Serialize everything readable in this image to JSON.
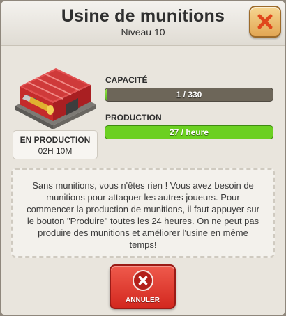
{
  "header": {
    "title": "Usine de munitions",
    "subtitle": "Niveau 10",
    "close_icon": "close-x-icon"
  },
  "status": {
    "label": "EN PRODUCTION",
    "time": "02H 10M"
  },
  "capacity": {
    "label": "CAPACITÉ",
    "value_text": "1 / 330",
    "current": 1,
    "max": 330
  },
  "production": {
    "label": "PRODUCTION",
    "value_text": "27 / heure"
  },
  "description": "Sans munitions, vous n'êtes rien ! Vous avez besoin de munitions pour attaquer les autres joueurs. Pour commencer la production de munitions, il faut appuyer sur le bouton \"Produire\" toutes les 24 heures. On ne peut pas produire des munitions et améliorer l'usine en même temps!",
  "cancel_button": {
    "label": "ANNULER",
    "icon": "cancel-x-icon"
  },
  "colors": {
    "accent_green": "#6bd021",
    "cancel_red": "#d3281f",
    "close_orange": "#e2a654"
  }
}
